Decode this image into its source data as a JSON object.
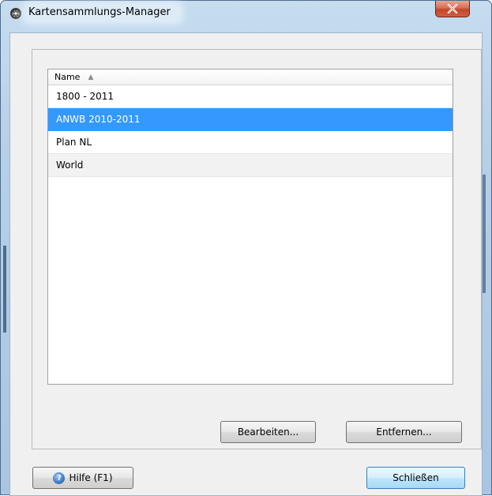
{
  "window": {
    "title": "Kartensammlungs-Manager",
    "icon": "app-globe-icon",
    "close_icon": "close-x-icon"
  },
  "list": {
    "column_header": "Name",
    "sort_indicator": "▲",
    "rows": [
      {
        "label": "1800 - 2011",
        "selected": false
      },
      {
        "label": "ANWB 2010-2011",
        "selected": true
      },
      {
        "label": "Plan NL",
        "selected": false
      },
      {
        "label": "World",
        "selected": false
      }
    ]
  },
  "buttons": {
    "edit": "Bearbeiten...",
    "remove": "Entfernen...",
    "help": "Hilfe (F1)",
    "close": "Schließen"
  },
  "colors": {
    "selection": "#3399ff",
    "close_button": "#c4452a"
  }
}
